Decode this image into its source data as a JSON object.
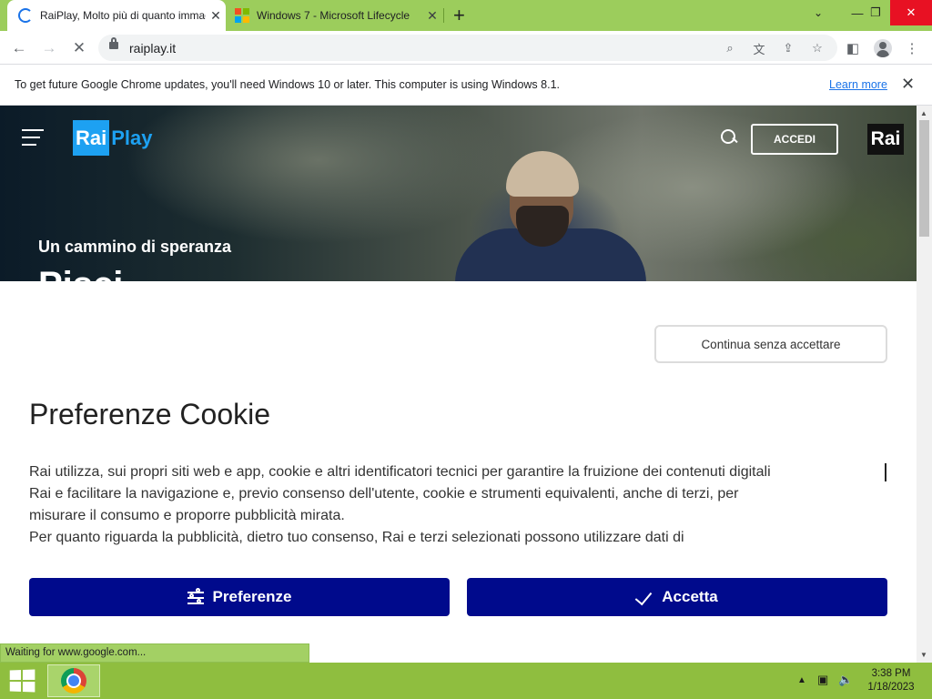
{
  "browser": {
    "tabs": [
      {
        "title": "RaiPlay, Molto più di quanto immaginavi",
        "active": true,
        "favicon": "loading-spinner-icon"
      },
      {
        "title": "Windows 7 - Microsoft Lifecycle",
        "active": false,
        "favicon": "microsoft-logo-icon"
      }
    ],
    "new_tab_symbol": "+",
    "window_controls": {
      "minimize": "—",
      "restore": "❐",
      "close": "✕",
      "tab_search": "⌄"
    },
    "url": "raiplay.it"
  },
  "infobar": {
    "message": "To get future Google Chrome updates, you'll need Windows 10 or later. This computer is using Windows 8.1.",
    "link": "Learn more",
    "close": "✕"
  },
  "site": {
    "header": {
      "logo_part1": "Rai",
      "logo_part2": "Play",
      "login_label": "ACCEDI",
      "brand_mark": "Rai"
    },
    "hero": {
      "subtitle": "Un cammino di speranza",
      "title_partial": "Pisci"
    }
  },
  "cookie": {
    "skip_button": "Continua senza accettare",
    "title": "Preferenze Cookie",
    "body_lines": [
      "Rai utilizza, sui propri siti web e app, cookie e altri identificatori tecnici per garantire la fruizione dei contenuti digitali",
      "Rai e facilitare la navigazione e, previo consenso dell'utente, cookie e strumenti equivalenti, anche di terzi, per",
      "misurare il consumo e proporre pubblicità mirata.",
      "Per quanto riguarda la pubblicità, dietro tuo consenso, Rai e terzi selezionati possono utilizzare dati di"
    ],
    "preferences_button": "Preferenze",
    "accept_button": "Accetta",
    "button_color": "#000a8c"
  },
  "status_bar": {
    "text": "Waiting for www.google.com..."
  },
  "taskbar": {
    "time": "3:38 PM",
    "date": "1/18/2023",
    "tray_icons": [
      "show-hidden-icons-icon",
      "network-icon",
      "volume-icon"
    ],
    "color": "#8fbe3f"
  }
}
